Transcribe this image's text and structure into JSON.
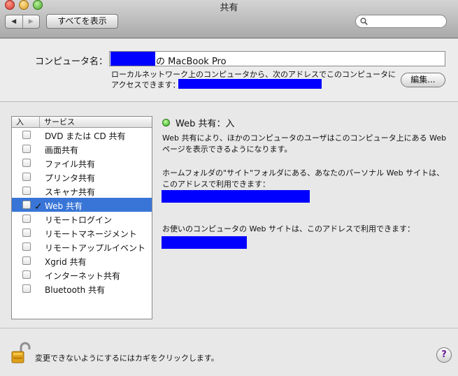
{
  "window": {
    "title": "共有"
  },
  "toolbar": {
    "back_icon": "◀",
    "forward_icon": "▶",
    "show_all_label": "すべてを表示",
    "search_placeholder": ""
  },
  "computer_name": {
    "label": "コンピュータ名：",
    "value_suffix": "の MacBook Pro",
    "info_line1": "ローカルネットワーク上のコンピュータから、次のアドレスでこのコンピュータに",
    "info_line2": "アクセスできます：",
    "edit_button": "編集..."
  },
  "services": {
    "header_on": "入",
    "header_service": "サービス",
    "items": [
      {
        "name": "DVD または CD 共有",
        "checked": false,
        "selected": false
      },
      {
        "name": "画面共有",
        "checked": false,
        "selected": false
      },
      {
        "name": "ファイル共有",
        "checked": false,
        "selected": false
      },
      {
        "name": "プリンタ共有",
        "checked": false,
        "selected": false
      },
      {
        "name": "スキャナ共有",
        "checked": false,
        "selected": false
      },
      {
        "name": "Web 共有",
        "checked": true,
        "selected": true
      },
      {
        "name": "リモートログイン",
        "checked": false,
        "selected": false
      },
      {
        "name": "リモートマネージメント",
        "checked": false,
        "selected": false
      },
      {
        "name": "リモートアップルイベント",
        "checked": false,
        "selected": false
      },
      {
        "name": "Xgrid 共有",
        "checked": false,
        "selected": false
      },
      {
        "name": "インターネット共有",
        "checked": false,
        "selected": false
      },
      {
        "name": "Bluetooth 共有",
        "checked": false,
        "selected": false
      }
    ]
  },
  "detail": {
    "status": "Web 共有：入",
    "status_color": "#2aa520",
    "desc1_line1": "Web 共有により、ほかのコンピュータのユーザはこのコンピュータ上にある Web",
    "desc1_line2": "ページを表示できるようになります。",
    "desc2_line1": "ホームフォルダの\"サイト\"フォルダにある、あなたのパーソナル Web サイトは、",
    "desc2_line2": "このアドレスで利用できます：",
    "desc3": "お使いのコンピュータの Web サイトは、このアドレスで利用できます："
  },
  "footer": {
    "lock_text": "変更できないようにするにはカギをクリックします。",
    "help_label": "?"
  }
}
